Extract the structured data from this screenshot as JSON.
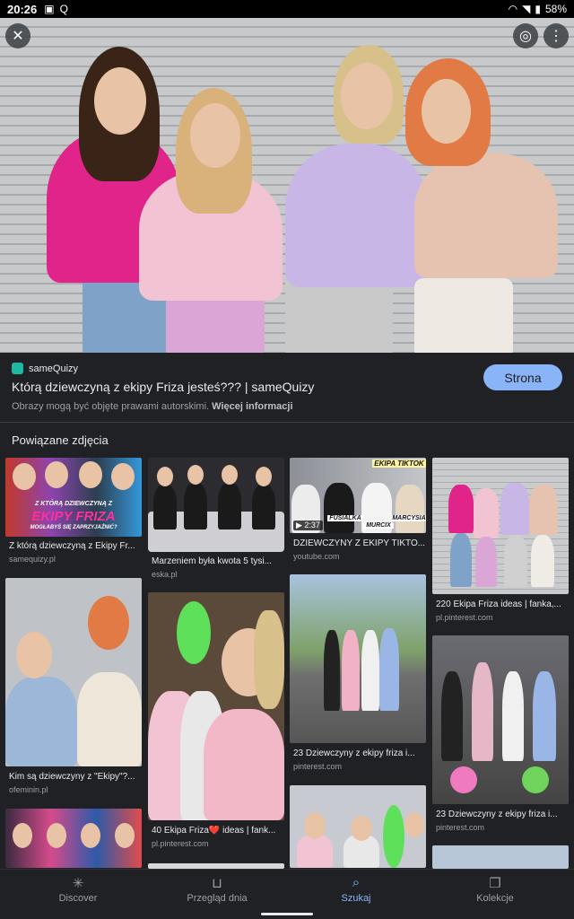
{
  "status": {
    "time": "20:26",
    "battery": "58%"
  },
  "result": {
    "source": "sameQuizy",
    "title": "Którą dziewczyną z ekipy Friza jesteś??? | sameQuizy",
    "visit_label": "Strona",
    "copyright": "Obrazy mogą być objęte prawami autorskimi.",
    "more_info": "Więcej informacji"
  },
  "related": {
    "heading": "Powiązane zdjęcia",
    "items": [
      {
        "caption": "Z którą dziewczyną z Ekipy Fr...",
        "domain": "samequizy.pl",
        "banner_line1": "Z KTÓRĄ DZIEWCZYNĄ Z",
        "banner_line2": "EKIPY FRIZA",
        "banner_line3": "MOGŁABYŚ SIĘ ZAPRZYJAŹNIĆ?"
      },
      {
        "caption": "Marzeniem była kwota 5 tysi...",
        "domain": "eska.pl"
      },
      {
        "caption": "DZIEWCZYNY Z EKIPY TIKTO...",
        "domain": "youtube.com",
        "duration": "2:37",
        "tag_top": "EKIPA TIKTOK",
        "name_a": "FUSIALKA",
        "name_b": "MURCIX",
        "name_c": "MARCYSIA"
      },
      {
        "caption": "220 Ekipa Friza ideas | fanka,...",
        "domain": "pl.pinterest.com"
      },
      {
        "caption": "Kim są dziewczyny z \"Ekipy\"?...",
        "domain": "ofeminin.pl"
      },
      {
        "caption": "40 Ekipa Friza❤️ ideas | fank...",
        "domain": "pl.pinterest.com"
      },
      {
        "caption": "23 Dziewczyny z ekipy friza i...",
        "domain": "pinterest.com"
      },
      {
        "caption": "23 Dziewczyny z ekipy friza i...",
        "domain": "pinterest.com"
      }
    ]
  },
  "nav": {
    "items": [
      {
        "label": "Discover",
        "icon": "asterisk-icon"
      },
      {
        "label": "Przegląd dnia",
        "icon": "inbox-icon"
      },
      {
        "label": "Szukaj",
        "icon": "search-icon"
      },
      {
        "label": "Kolekcje",
        "icon": "collections-icon"
      }
    ],
    "active": "Szukaj"
  },
  "colors": {
    "accent": "#8ab4f8",
    "background": "#202124"
  }
}
